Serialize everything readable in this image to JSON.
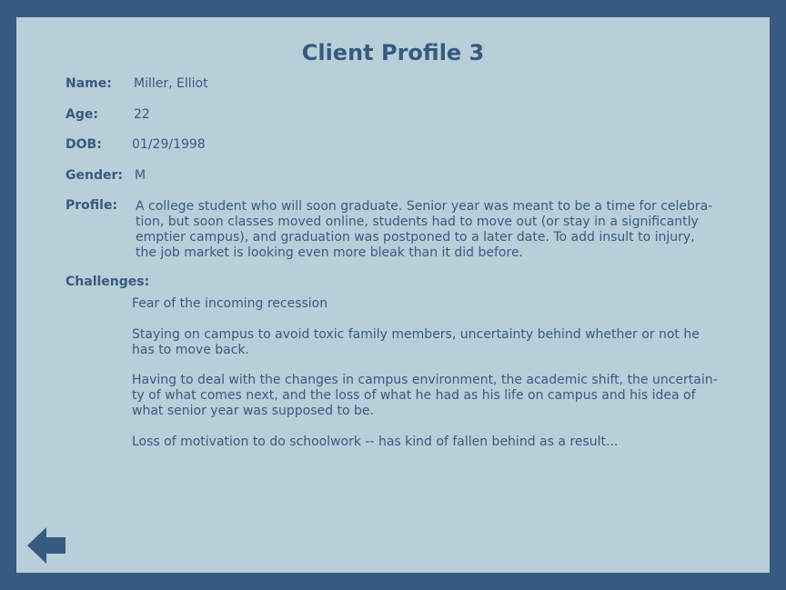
{
  "title": "Client Profile 3",
  "fields": {
    "name_label": "Name:",
    "name_value": "Miller, Elliot",
    "age_label": "Age:",
    "age_value": "22",
    "dob_label": "DOB:",
    "dob_value": "01/29/1998",
    "gender_label": "Gender:",
    "gender_value": "M",
    "profile_label": "Profile:",
    "challenges_label": "Challenges:"
  },
  "profile_lines": [
    "A college student who will soon graduate. Senior year was meant to be a time for celebra-",
    "tion, but soon classes moved online, students had to move out (or stay in a significantly",
    "emptier campus), and graduation was postponed to a later date. To add insult to injury,",
    "the job market is looking even more bleak than it did before."
  ],
  "challenges": [
    {
      "lines": [
        "Fear of the incoming recession"
      ]
    },
    {
      "lines": [
        "Staying on campus to avoid toxic family members, uncertainty behind whether or not he",
        "has to move back."
      ]
    },
    {
      "lines": [
        "Having to deal with the changes in campus environment, the academic shift, the uncertain-",
        "ty of what comes next, and the loss of what he had as his life on campus and his idea of",
        "what senior year was supposed to be."
      ]
    },
    {
      "lines": [
        "Loss of motivation to do schoolwork -- has kind of fallen behind as a result..."
      ]
    }
  ],
  "navigation": {
    "back_icon": "left-arrow-icon"
  },
  "colors": {
    "frame": "#375a80",
    "panel": "#b8cfd9",
    "text": "#375a80"
  }
}
